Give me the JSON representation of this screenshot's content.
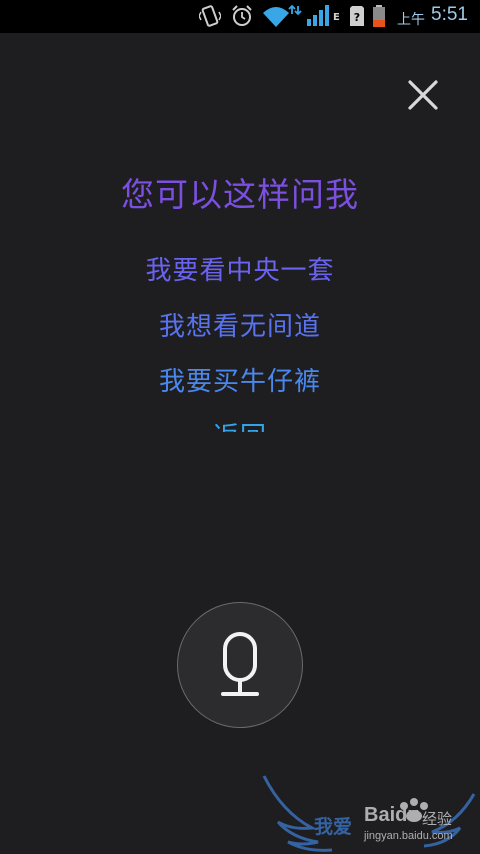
{
  "status_bar": {
    "time_label": "上午",
    "time": "5:51",
    "network_type": "E",
    "icons": [
      "vibrate-icon",
      "alarm-icon",
      "wifi-icon",
      "signal-icon",
      "sim-icon",
      "battery-icon"
    ],
    "colors": {
      "time": "#9ecbe8",
      "wifi": "#39a7e6",
      "battery": "#e8531c"
    }
  },
  "close": {
    "icon": "close-icon"
  },
  "hints": {
    "title": "您可以这样问我",
    "items": [
      {
        "label": "我要看中央一套",
        "color": "#6a63f0"
      },
      {
        "label": "我想看无间道",
        "color": "#5872f0"
      },
      {
        "label": "我要买牛仔裤",
        "color": "#4a88ee"
      },
      {
        "label": "返回",
        "color": "#33a3ea"
      }
    ]
  },
  "mic": {
    "icon": "microphone-icon"
  },
  "watermark": {
    "cn": "我爱",
    "brand": "Baidu",
    "brand_suffix": "经验",
    "url": "jingyan.baidu.com"
  }
}
